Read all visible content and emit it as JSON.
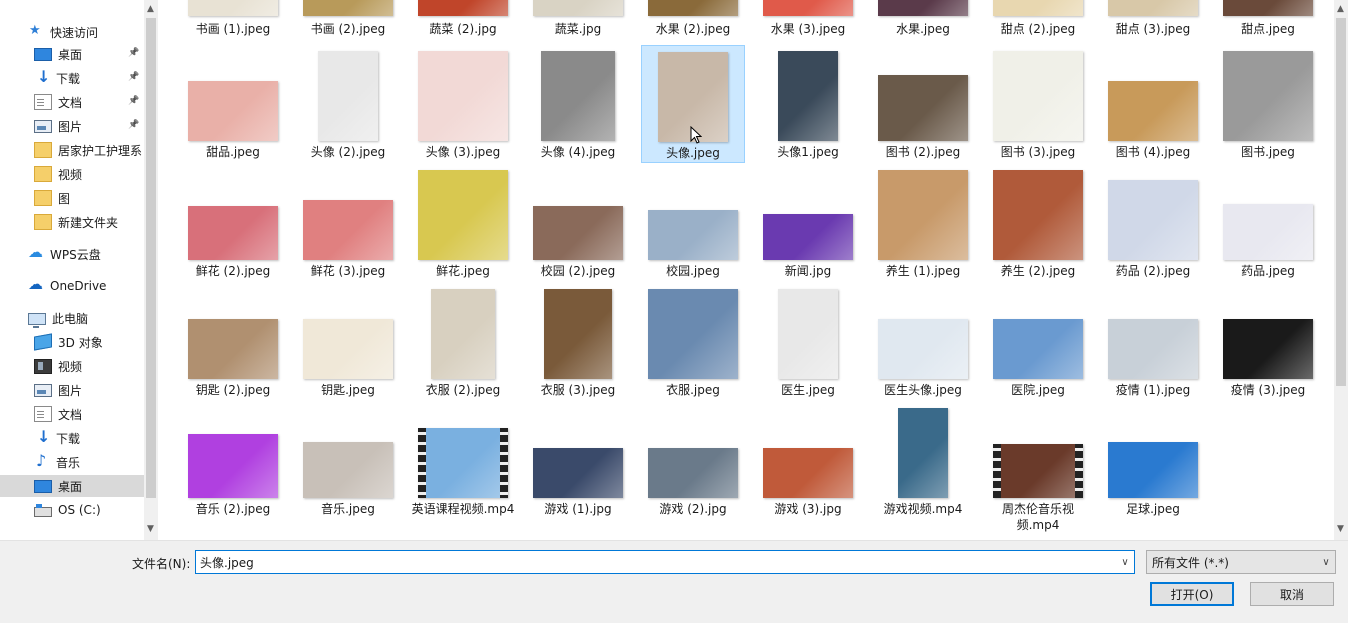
{
  "nav": {
    "items": [
      {
        "label": "快速访问",
        "icon": "star-icon",
        "pinned": false
      },
      {
        "label": "桌面",
        "icon": "desktop-folder-icon",
        "pinned": true
      },
      {
        "label": "下载",
        "icon": "download-icon",
        "pinned": true
      },
      {
        "label": "文档",
        "icon": "document-icon",
        "pinned": true
      },
      {
        "label": "图片",
        "icon": "pictures-icon",
        "pinned": true
      },
      {
        "label": "居家护工护理系",
        "icon": "folder-icon",
        "pinned": false
      },
      {
        "label": "视频",
        "icon": "folder-icon",
        "pinned": false
      },
      {
        "label": "图",
        "icon": "folder-icon",
        "pinned": false
      },
      {
        "label": "新建文件夹",
        "icon": "folder-icon",
        "pinned": false
      },
      {
        "label": "WPS云盘",
        "icon": "wps-cloud-icon",
        "pinned": false
      },
      {
        "label": "OneDrive",
        "icon": "onedrive-icon",
        "pinned": false
      },
      {
        "label": "此电脑",
        "icon": "this-pc-icon",
        "pinned": false
      },
      {
        "label": "3D 对象",
        "icon": "3d-objects-icon",
        "pinned": false
      },
      {
        "label": "视频",
        "icon": "videos-icon",
        "pinned": false
      },
      {
        "label": "图片",
        "icon": "pictures-icon",
        "pinned": false
      },
      {
        "label": "文档",
        "icon": "document-icon",
        "pinned": false
      },
      {
        "label": "下载",
        "icon": "download-icon",
        "pinned": false
      },
      {
        "label": "音乐",
        "icon": "music-icon",
        "pinned": false
      },
      {
        "label": "桌面",
        "icon": "desktop-folder-icon",
        "pinned": false
      },
      {
        "label": "OS (C:)",
        "icon": "drive-icon",
        "pinned": false
      }
    ],
    "selected_label": "桌面"
  },
  "files": {
    "row1": [
      "书画 (1).jpeg",
      "书画 (2).jpeg",
      "蔬菜 (2).jpg",
      "蔬菜.jpg",
      "水果 (2).jpeg",
      "水果 (3).jpeg",
      "水果.jpeg",
      "甜点 (2).jpeg",
      "甜点 (3).jpeg",
      "甜点.jpeg"
    ],
    "row2": [
      "甜品.jpeg",
      "头像 (2).jpeg",
      "头像 (3).jpeg",
      "头像 (4).jpeg",
      "头像.jpeg",
      "头像1.jpeg",
      "图书 (2).jpeg",
      "图书 (3).jpeg",
      "图书 (4).jpeg",
      "图书.jpeg"
    ],
    "row3": [
      "鲜花 (2).jpeg",
      "鲜花 (3).jpeg",
      "鲜花.jpeg",
      "校园 (2).jpeg",
      "校园.jpeg",
      "新闻.jpg",
      "养生 (1).jpeg",
      "养生 (2).jpeg",
      "药品 (2).jpeg",
      "药品.jpeg"
    ],
    "row4": [
      "钥匙 (2).jpeg",
      "钥匙.jpeg",
      "衣服 (2).jpeg",
      "衣服 (3).jpeg",
      "衣服.jpeg",
      "医生.jpeg",
      "医生头像.jpeg",
      "医院.jpeg",
      "疫情 (1).jpeg",
      "疫情 (3).jpeg"
    ],
    "row5": [
      "音乐 (2).jpeg",
      "音乐.jpeg",
      "英语课程视频.mp4",
      "游戏 (1).jpg",
      "游戏 (2).jpg",
      "游戏 (3).jpg",
      "游戏视频.mp4",
      "周杰伦音乐视频.mp4",
      "足球.jpeg"
    ],
    "selected": "头像.jpeg"
  },
  "thumb_colors": {
    "row1": [
      "#e8e2d4",
      "#b89a5a",
      "#c0452a",
      "#d9d3c4",
      "#8a6a3a",
      "#e05a4a",
      "#5a3a4a",
      "#e8d7b0",
      "#d8c8a8",
      "#6a4a3a"
    ],
    "row2": [
      "#e9b0a8",
      "#e8e8e8",
      "#f2d9d6",
      "#8a8a8a",
      "#c8b8a8",
      "#3a4a5a",
      "#6a5a4a",
      "#f0f0e8",
      "#c89a5a",
      "#9a9a9a"
    ],
    "row3": [
      "#d8707a",
      "#e08080",
      "#d8c850",
      "#8a6a5a",
      "#9ab0c8",
      "#6a3ab0",
      "#c89a6a",
      "#b05a3a",
      "#d0d8e8",
      "#e8e8f0"
    ],
    "row4": [
      "#b09070",
      "#f0e8d8",
      "#d8d0c0",
      "#7a5a3a",
      "#6a8ab0",
      "#e8e8e8",
      "#e0e8f0",
      "#6a9ad0",
      "#c8d0d8",
      "#1a1a1a"
    ],
    "row5": [
      "#b040e0",
      "#c8c0b8",
      "#7ab0e0",
      "#3a4a6a",
      "#6a7a8a",
      "#c05a3a",
      "#3a6a8a",
      "#6a3a2a",
      "#2a7ad0"
    ]
  },
  "bottom": {
    "filename_label": "文件名(N):",
    "filename_value": "头像.jpeg",
    "filter_value": "所有文件 (*.*)",
    "open_label": "打开(O)",
    "cancel_label": "取消"
  },
  "colors": {
    "accent": "#0078d7",
    "selection_bg": "#cce8ff",
    "selection_border": "#99d1ff"
  }
}
